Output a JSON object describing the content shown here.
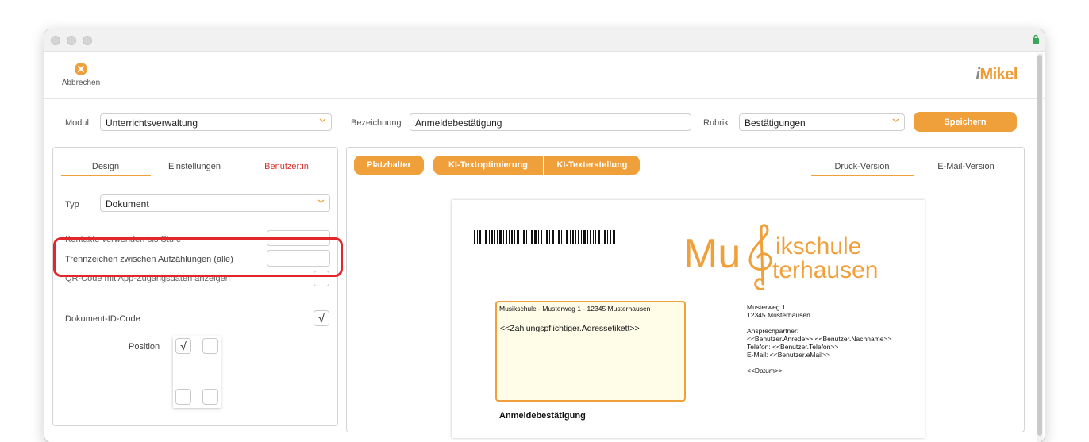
{
  "toolbar": {
    "cancel_label": "Abbrechen",
    "logo_i": "i",
    "logo_rest": "Mikel"
  },
  "form": {
    "modul_label": "Modul",
    "modul_value": "Unterrichtsverwaltung",
    "bezeichnung_label": "Bezeichnung",
    "bezeichnung_value": "Anmeldebestätigung",
    "rubrik_label": "Rubrik",
    "rubrik_value": "Bestätigungen",
    "save_label": "Speichern"
  },
  "left_panel": {
    "tabs": [
      {
        "label": "Design"
      },
      {
        "label": "Einstellungen"
      },
      {
        "label": "Benutzer:in"
      }
    ],
    "typ_label": "Typ",
    "typ_value": "Dokument",
    "kontakte_label": "Kontakte verwenden bis Stufe",
    "trennzeichen_label": "Trennzeichen zwischen Aufzählungen (alle)",
    "qr_label": "QR-Code mit App-Zugangsdaten anzeigen",
    "docid_label": "Dokument-ID-Code",
    "docid_checked": "√",
    "position_label": "Position",
    "pos_checked": "√"
  },
  "right_panel": {
    "buttons": [
      {
        "label": "Platzhalter"
      },
      {
        "label": "KI-Textoptimierung"
      },
      {
        "label": "KI-Texterstellung"
      }
    ],
    "tabs": [
      {
        "label": "Druck-Version"
      },
      {
        "label": "E-Mail-Version"
      }
    ]
  },
  "document": {
    "brand_line1": "ikschule",
    "brand_line2": "terhausen",
    "brand_mu": "Mu",
    "sender_line": "Musikschule - Musterweg 1 - 12345 Musterhausen",
    "address_placeholder": "<<Zahlungspflichtiger.Adressetikett>>",
    "right_block": "Musterweg 1\n12345 Musterhausen\n\nAnsprechpartner:\n<<Benutzer.Anrede>> <<Benutzer.Nachname>>\nTelefon: <<Benutzer.Telefon>>\nE-Mail: <<Benutzer.eMail>>\n\n<<Datum>>",
    "heading": "Anmeldebestätigung"
  },
  "colors": {
    "accent": "#f0a03a",
    "highlight": "#e3262a",
    "address_bg": "#fffde8"
  }
}
